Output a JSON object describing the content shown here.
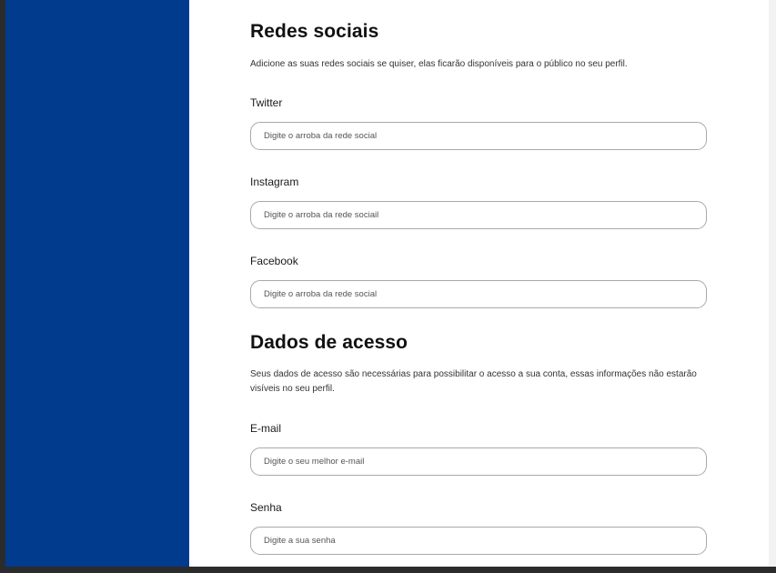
{
  "social": {
    "title": "Redes sociais",
    "description": "Adicione as suas redes sociais se quiser, elas ficarão disponíveis para o público no seu perfil.",
    "twitter": {
      "label": "Twitter",
      "placeholder": "Digite o arroba da rede social"
    },
    "instagram": {
      "label": "Instagram",
      "placeholder": "Digite o arroba da rede sociail"
    },
    "facebook": {
      "label": "Facebook",
      "placeholder": "Digite o arroba da rede social"
    }
  },
  "access": {
    "title": "Dados de acesso",
    "description": "Seus dados de acesso são necessárias para possibilitar o acesso a sua conta, essas informações não estarão visíveis no seu perfil.",
    "email": {
      "label": "E-mail",
      "placeholder": "Digite o seu melhor e-mail"
    },
    "password": {
      "label": "Senha",
      "placeholder": "Digite a sua senha"
    }
  },
  "colors": {
    "sidebar": "#003b8e",
    "background": "#ffffff",
    "input_border": "#a9a9a9"
  }
}
